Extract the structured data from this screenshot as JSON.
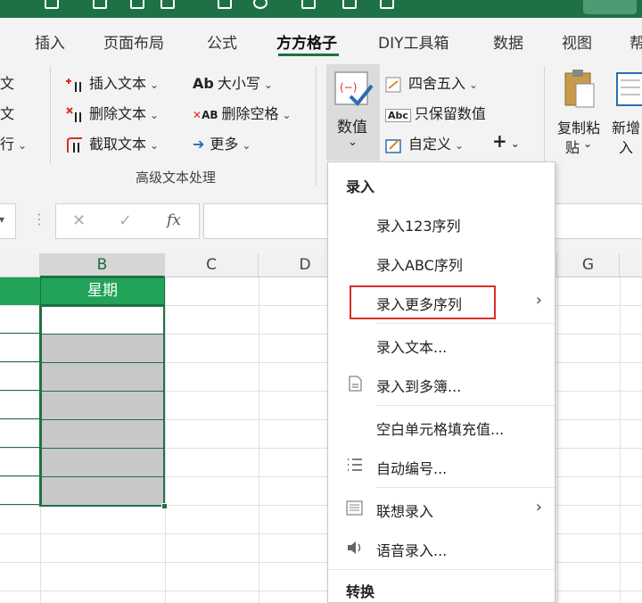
{
  "tabs": [
    "插入",
    "页面布局",
    "公式",
    "方方格子",
    "DIY工具箱",
    "数据",
    "视图",
    "帮"
  ],
  "ribbon": {
    "left_partial": [
      "文",
      "文",
      "行"
    ],
    "text_group": {
      "insert_text": "插入文本",
      "delete_text": "删除文本",
      "extract_text": "截取文本",
      "case": "大小写",
      "delete_spaces": "删除空格",
      "more": "更多",
      "label": "高级文本处理"
    },
    "numeric": {
      "value_button": "数值",
      "round": "四舍五入",
      "keep_value": "只保留数值",
      "custom": "自定义",
      "plus": "+"
    },
    "copy_paste": "复制粘贴",
    "copy_paste_line1": "复制粘",
    "copy_paste_line2": "贴",
    "new_add_line1": "新增",
    "new_add_line2": "入"
  },
  "formula_bar": {
    "cancel": "✕",
    "confirm": "✓",
    "fx": "fx"
  },
  "grid": {
    "columns": [
      "B",
      "C",
      "D",
      "G"
    ],
    "header_cell": "星期"
  },
  "menu": {
    "section_entry": "录入",
    "items": [
      {
        "label": "录入123序列",
        "arrow": false
      },
      {
        "label": "录入ABC序列",
        "arrow": false
      },
      {
        "label": "录入更多序列",
        "arrow": true,
        "highlight": true
      },
      {
        "label": "录入文本...",
        "arrow": false
      },
      {
        "label": "录入到多簿...",
        "arrow": false
      },
      {
        "label": "空白单元格填充值...",
        "arrow": false
      },
      {
        "label": "自动编号...",
        "arrow": false
      },
      {
        "label": "联想录入",
        "arrow": true
      },
      {
        "label": "语音录入...",
        "arrow": false
      }
    ],
    "section_convert": "转换"
  },
  "colors": {
    "excel_green": "#1e7145",
    "header_green": "#21a35a",
    "highlight_red": "#d93025",
    "selection_gray": "#c8c8c8"
  }
}
